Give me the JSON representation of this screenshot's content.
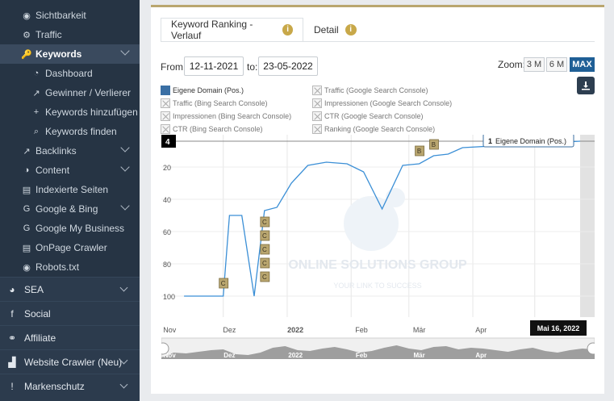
{
  "sidebar": {
    "sub_items": [
      {
        "icon": "eye-icon",
        "glyph": "◉",
        "label": "Sichtbarkeit"
      },
      {
        "icon": "gears-icon",
        "glyph": "⚙",
        "label": "Traffic"
      },
      {
        "icon": "key-icon",
        "glyph": "🔑",
        "label": "Keywords"
      },
      {
        "icon": "dashboard-icon",
        "glyph": "◔",
        "label": "Dashboard"
      },
      {
        "icon": "external-link-icon",
        "glyph": "↗",
        "label": "Gewinner / Verlierer"
      },
      {
        "icon": "plus-icon",
        "glyph": "+",
        "label": "Keywords hinzufügen"
      },
      {
        "icon": "search-icon",
        "glyph": "⌕",
        "label": "Keywords finden"
      },
      {
        "icon": "external-link-icon",
        "glyph": "↗",
        "label": "Backlinks"
      },
      {
        "icon": "content-icon",
        "glyph": "◑",
        "label": "Content"
      },
      {
        "icon": "document-icon",
        "glyph": "▤",
        "label": "Indexierte Seiten"
      },
      {
        "icon": "google-icon",
        "glyph": "G",
        "label": "Google & Bing"
      },
      {
        "icon": "google-icon",
        "glyph": "G",
        "label": "Google My Business"
      },
      {
        "icon": "document-icon",
        "glyph": "▤",
        "label": "OnPage Crawler"
      },
      {
        "icon": "eye-icon",
        "glyph": "◉",
        "label": "Robots.txt"
      }
    ],
    "main_items": [
      {
        "icon": "pie-chart-icon",
        "glyph": "◕",
        "label": "SEA"
      },
      {
        "icon": "facebook-icon",
        "glyph": "f",
        "label": "Social"
      },
      {
        "icon": "handshake-icon",
        "glyph": "⚭",
        "label": "Affiliate"
      },
      {
        "icon": "bar-chart-icon",
        "glyph": "▟",
        "label": "Website Crawler (Neu)"
      },
      {
        "icon": "exclamation-icon",
        "glyph": "!",
        "label": "Markenschutz"
      }
    ]
  },
  "tabs": [
    {
      "label": "Keyword Ranking - Verlauf",
      "info": "i"
    },
    {
      "label": "Detail",
      "info": "i"
    }
  ],
  "filters": {
    "from_label": "From:",
    "from_value": "12-11-2021",
    "to_label": "to:",
    "to_value": "23-05-2022",
    "zoom_label": "Zoom:",
    "zoom_options": [
      "3 M",
      "6 M",
      "MAX"
    ],
    "zoom_selected": "MAX"
  },
  "legend": [
    {
      "label": "Eigene Domain (Pos.)",
      "enabled": true
    },
    {
      "label": "Traffic (Google Search Console)",
      "enabled": false
    },
    {
      "label": "Traffic (Bing Search Console)",
      "enabled": false
    },
    {
      "label": "Impressionen (Google Search Console)",
      "enabled": false
    },
    {
      "label": "Impressionen (Bing Search Console)",
      "enabled": false
    },
    {
      "label": "CTR (Google Search Console)",
      "enabled": false
    },
    {
      "label": "CTR (Bing Search Console)",
      "enabled": false
    },
    {
      "label": "Ranking (Google Search Console)",
      "enabled": false
    }
  ],
  "chart_data": {
    "type": "line",
    "y_axis": {
      "reversed": true,
      "ticks": [
        20,
        40,
        60,
        80,
        100
      ],
      "range": [
        4,
        115
      ]
    },
    "x_axis": {
      "tick_labels": [
        "Nov",
        "Dez",
        "2022",
        "Feb",
        "Mär",
        "Apr"
      ]
    },
    "series": [
      {
        "name": "Eigene Domain (Pos.)",
        "color": "#3b8fd6",
        "points": [
          [
            "2021-11-12",
            100
          ],
          [
            "2021-11-22",
            100
          ],
          [
            "2021-12-01",
            100
          ],
          [
            "2021-12-04",
            50
          ],
          [
            "2021-12-10",
            50
          ],
          [
            "2021-12-16",
            100
          ],
          [
            "2021-12-21",
            47
          ],
          [
            "2021-12-27",
            45
          ],
          [
            "2022-01-03",
            30
          ],
          [
            "2022-01-11",
            19
          ],
          [
            "2022-01-20",
            17
          ],
          [
            "2022-01-30",
            18
          ],
          [
            "2022-02-07",
            23
          ],
          [
            "2022-02-16",
            46
          ],
          [
            "2022-02-26",
            19
          ],
          [
            "2022-03-06",
            18
          ],
          [
            "2022-03-13",
            13
          ],
          [
            "2022-03-20",
            12
          ],
          [
            "2022-03-27",
            8
          ],
          [
            "2022-05-23",
            4
          ]
        ]
      }
    ],
    "flags": [
      {
        "date": "2021-12-01",
        "label": "C"
      },
      {
        "date": "2021-12-21",
        "label": "C"
      },
      {
        "date": "2021-12-21",
        "label": "C"
      },
      {
        "date": "2021-12-21",
        "label": "C"
      },
      {
        "date": "2021-12-21",
        "label": "C"
      },
      {
        "date": "2021-12-21",
        "label": "C"
      },
      {
        "date": "2022-03-06",
        "label": "B"
      },
      {
        "date": "2022-03-13",
        "label": "B"
      }
    ],
    "crosshair_label": "4",
    "tooltip": {
      "rank": "1",
      "series": "Eigene Domain (Pos.)"
    },
    "date_badge": "Mai 16, 2022",
    "navigator_labels": [
      "Nov",
      "Dez",
      "2022",
      "Feb",
      "Mär",
      "Apr"
    ],
    "watermark": {
      "line1": "ONLINE SOLUTIONS GROUP",
      "line2": "YOUR LINK TO SUCCESS"
    },
    "colors": {
      "flag_fill": "#b9a66f",
      "flag_stroke": "#7a6b3e",
      "navigator_area": "#8f8f8f"
    }
  }
}
